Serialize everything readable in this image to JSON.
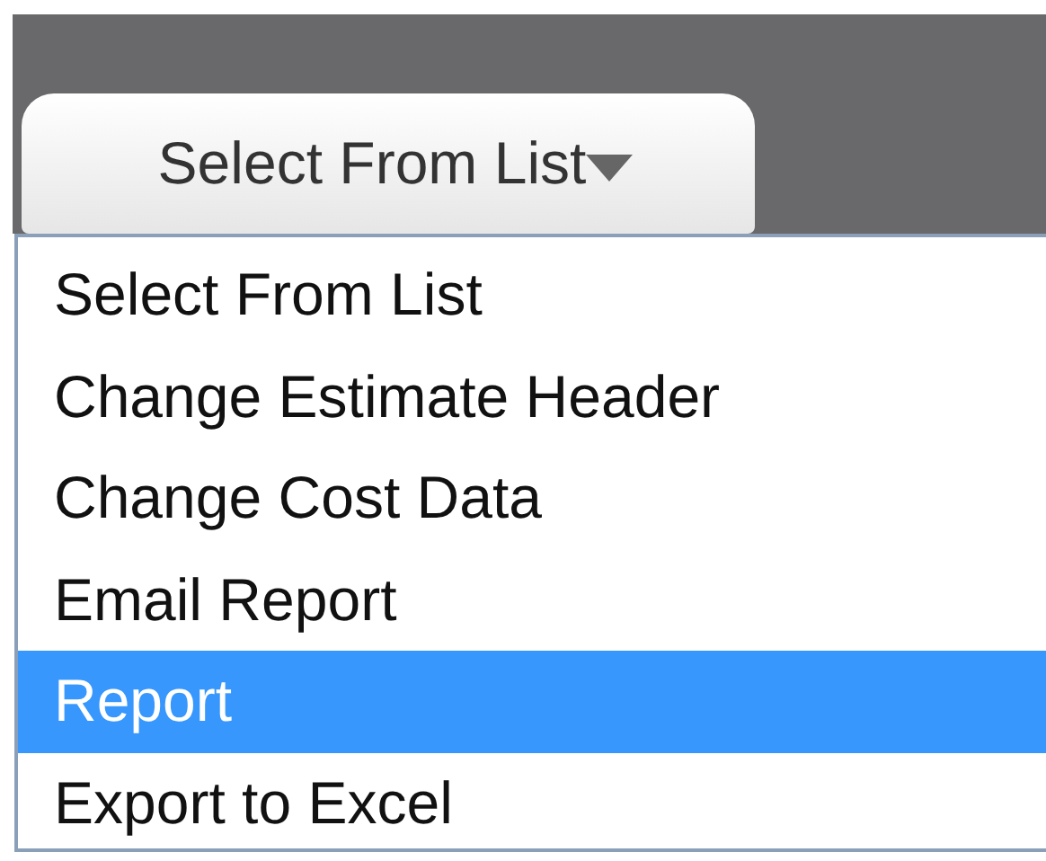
{
  "select": {
    "value": "Select From List"
  },
  "options": [
    {
      "label": "Select From List",
      "selected": false
    },
    {
      "label": "Change Estimate Header",
      "selected": false
    },
    {
      "label": "Change Cost Data",
      "selected": false
    },
    {
      "label": "Email Report",
      "selected": false
    },
    {
      "label": "Report",
      "selected": true
    },
    {
      "label": "Export to Excel",
      "selected": false
    }
  ]
}
